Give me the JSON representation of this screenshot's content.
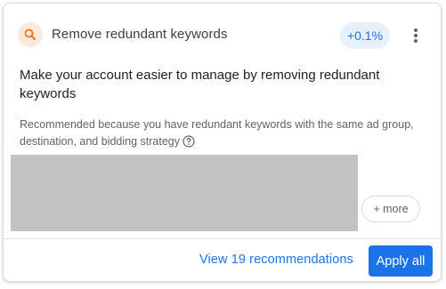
{
  "card": {
    "title": "Remove redundant keywords",
    "type_icon": "search-icon",
    "uplift": "+0.1%",
    "menu_icon": "more-vert-icon",
    "headline": "Make your account easier to manage by removing redundant keywords",
    "reason": "Recommended because you have redundant keywords with the same ad group, destination, and bidding strategy",
    "help_icon": "help-circle-icon",
    "more_chip": "+ more"
  },
  "footer": {
    "view_link": "View 19 recommendations",
    "apply_button": "Apply all"
  },
  "colors": {
    "accent": "#1a73e8",
    "badge_bg": "#e8f0fe",
    "icon_bg": "#fde9dc",
    "icon_fg": "#e8710a"
  }
}
